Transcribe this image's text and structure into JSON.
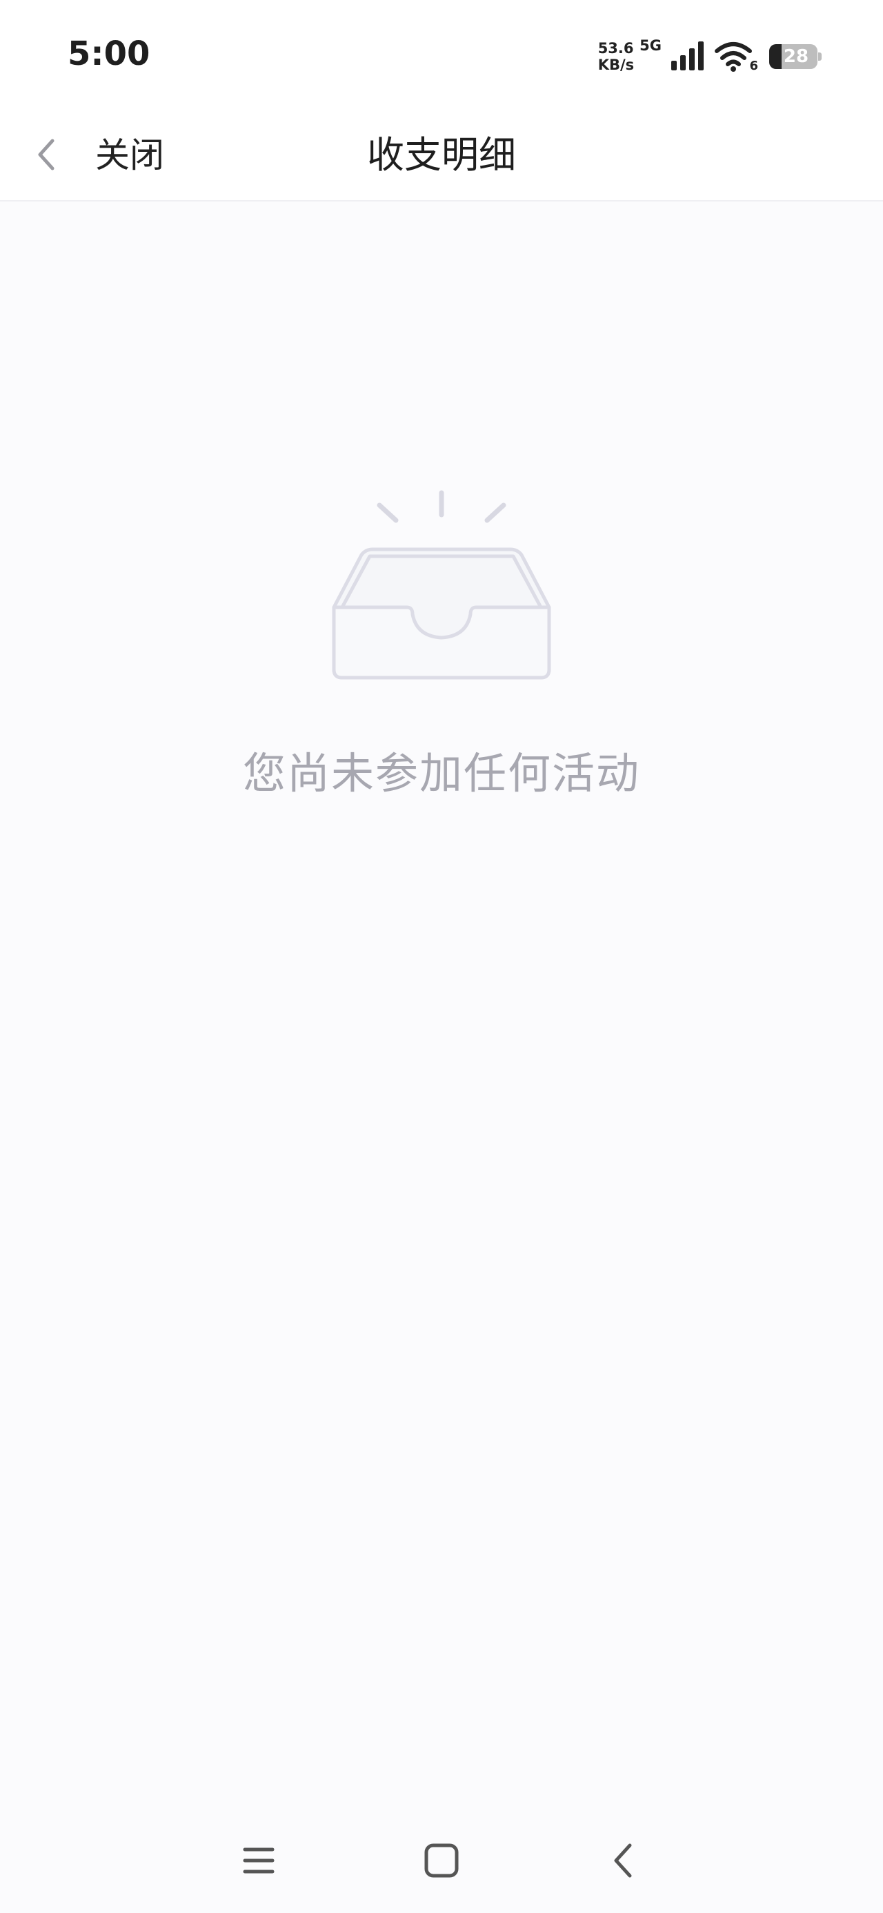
{
  "status_bar": {
    "time": "5:00",
    "net_speed_value": "53.6",
    "net_speed_unit": "KB/s",
    "network_type": "5G",
    "wifi_label": "6",
    "battery": "28"
  },
  "header": {
    "close_label": "关闭",
    "title": "收支明细"
  },
  "empty_state": {
    "message": "您尚未参加任何活动"
  },
  "icons": {
    "back": "chevron-left-icon",
    "empty": "empty-inbox-icon",
    "menu": "menu-icon",
    "home": "home-icon",
    "system_back": "system-back-icon"
  }
}
